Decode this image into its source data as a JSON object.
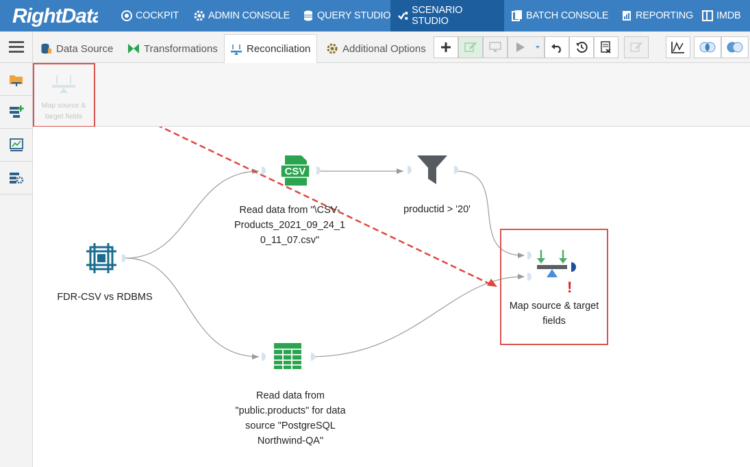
{
  "app": {
    "logo": "RightData",
    "colors": {
      "nav_bg": "#3a7fc1",
      "nav_active": "#1c5e9e",
      "accent_red": "#d9534f"
    }
  },
  "topnav": {
    "items": [
      {
        "label": "COCKPIT",
        "icon": "cockpit-icon"
      },
      {
        "label": "ADMIN CONSOLE",
        "icon": "gear-icon"
      },
      {
        "label": "QUERY STUDIO",
        "icon": "database-icon"
      },
      {
        "label": "SCENARIO STUDIO",
        "icon": "scenario-icon",
        "active": true
      },
      {
        "label": "BATCH CONSOLE",
        "icon": "batch-icon"
      },
      {
        "label": "REPORTING",
        "icon": "report-icon"
      },
      {
        "label": "IMDB",
        "icon": "imdb-icon"
      }
    ]
  },
  "tabs": [
    {
      "label": "Data Source",
      "icon": "database-icon"
    },
    {
      "label": "Transformations",
      "icon": "bowtie-icon"
    },
    {
      "label": "Reconciliation",
      "icon": "scale-icon",
      "active": true
    },
    {
      "label": "Additional Options",
      "icon": "gear-icon"
    }
  ],
  "toolbar": {
    "buttons": [
      "add-icon",
      "edit-icon",
      "monitor-icon",
      "play-icon",
      "undo-icon",
      "history-icon",
      "report-icon",
      "edit-icon",
      "chart-icon",
      "venn-icon",
      "venn-icon"
    ]
  },
  "sidebar": {
    "items": [
      "folder-icon",
      "add-table-icon",
      "chart-icon",
      "table-settings-icon"
    ]
  },
  "palette": {
    "item_label": "Map source & target fields"
  },
  "nodes": {
    "fdr": "FDR-CSV vs RDBMS",
    "csv_line1": "Read data from \"\\CSV-",
    "csv_line2": "Products_2021_09_24_1",
    "csv_line3": "0_11_07.csv\"",
    "csv_badge": "CSV",
    "filter": "productid > '20'",
    "pg_line1": "Read data from",
    "pg_line2": "\"public.products\" for data",
    "pg_line3": "source \"PostgreSQL",
    "pg_line4": "Northwind-QA\"",
    "map_line1": "Map source & target",
    "map_line2": "fields",
    "map_warning": "!"
  }
}
